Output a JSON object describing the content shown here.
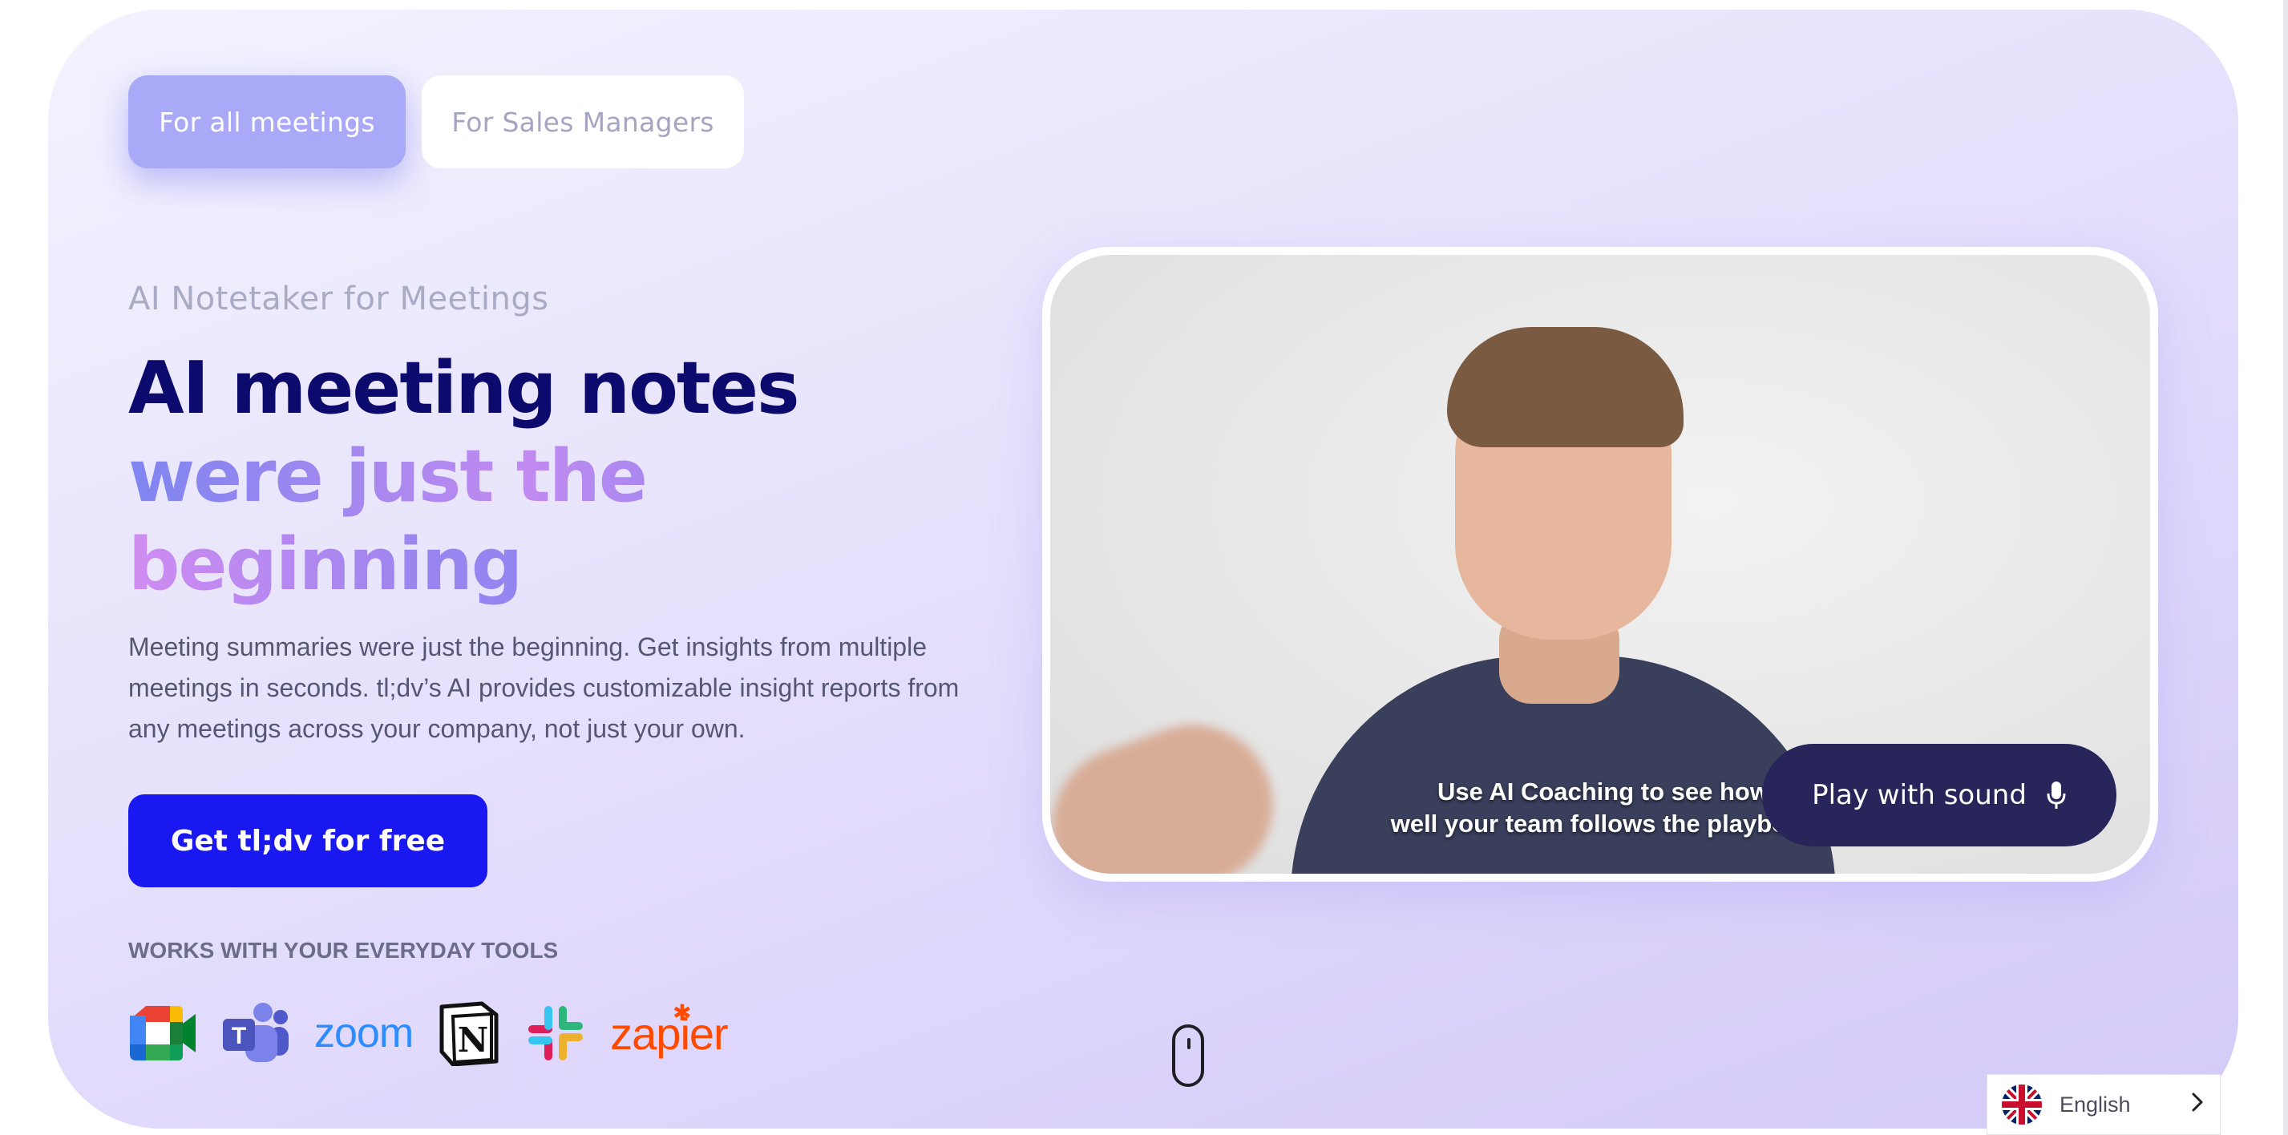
{
  "tabs": [
    {
      "label": "For all meetings",
      "active": true
    },
    {
      "label": "For Sales Managers",
      "active": false
    }
  ],
  "hero": {
    "eyebrow": "AI Notetaker for Meetings",
    "headline_line1": "AI meeting notes",
    "headline_line2": "were just the",
    "headline_line3": "beginning",
    "description": "Meeting summaries were just the beginning. Get insights from multiple meetings in seconds. tl;dv’s AI provides customizable insight reports from any meetings across your company, not just your own.",
    "cta_label": "Get tl;dv for free",
    "works_with": "WORKS WITH YOUR EVERYDAY TOOLS"
  },
  "integrations": [
    {
      "name": "google-meet",
      "icon": "google-meet-icon"
    },
    {
      "name": "microsoft-teams",
      "icon": "teams-icon"
    },
    {
      "name": "zoom",
      "label": "zoom"
    },
    {
      "name": "notion",
      "icon": "notion-icon"
    },
    {
      "name": "slack",
      "icon": "slack-icon"
    },
    {
      "name": "zapier",
      "label": "zapier"
    }
  ],
  "video": {
    "caption_line1": "Use AI Coaching to see how",
    "caption_line2": "well your team follows the playbook",
    "play_label": "Play with sound"
  },
  "language": {
    "label": "English"
  },
  "colors": {
    "cta": "#1a18f0",
    "tab_active": "#a9a9f7",
    "headline_dark": "#0d0a6e",
    "play_button": "#27255a"
  }
}
